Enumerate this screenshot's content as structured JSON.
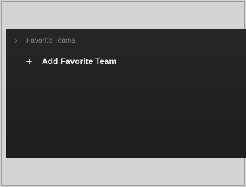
{
  "section": {
    "title": "Favorite Teams",
    "collapse_icon": "chevron-right-icon"
  },
  "action": {
    "add_label": "Add Favorite Team",
    "add_icon": "plus-icon"
  }
}
